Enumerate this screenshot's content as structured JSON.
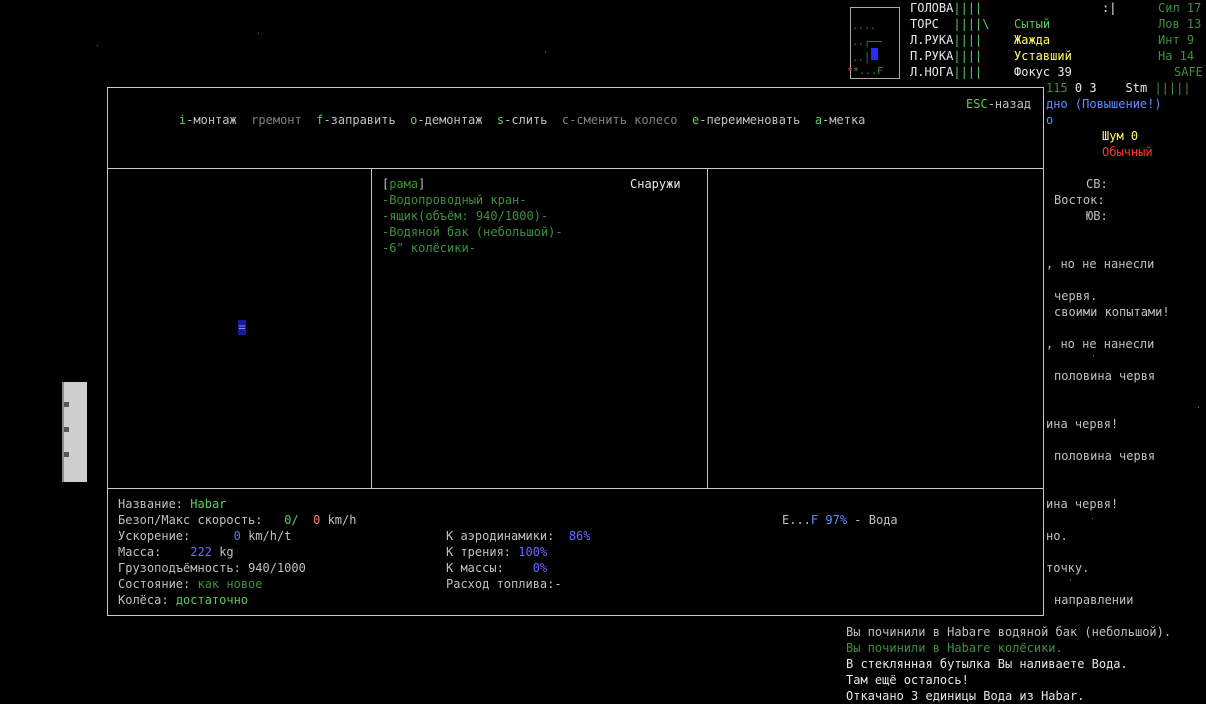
{
  "status": {
    "body_parts": [
      {
        "name": "ГОЛОВА",
        "bars": "||||"
      },
      {
        "name": "ТОРС",
        "bars": "||||\\"
      },
      {
        "name": "Л.РУКА",
        "bars": "||||"
      },
      {
        "name": "П.РУКА",
        "bars": "||||"
      },
      {
        "name": "Л.НОГА",
        "bars": "||||"
      }
    ],
    "needs": [
      "Сытый",
      "Жажда",
      "Уставший",
      "Фокус 39"
    ],
    "cursor_mark": ":|",
    "stats": [
      "Сил 17",
      "Лов 13",
      "Инт 9",
      "На 14",
      "SAFE"
    ],
    "row6": {
      "val1": "115",
      "val2": "0",
      "val3": "3",
      "stm_label": "Stm",
      "stm_bars": "|||||"
    },
    "minimap": {
      "rows": [
        "....",
        "..┌──",
        "..│",
        "*...F"
      ]
    }
  },
  "toolbar": {
    "items": [
      {
        "key": "i",
        "label": "-монтаж",
        "color": "#5fc85f",
        "label_color": "#c0c0c0"
      },
      {
        "key": "r",
        "label": "ремонт",
        "color": "#808080",
        "label_color": "#808080"
      },
      {
        "key": "f",
        "label": "-заправить",
        "color": "#5fc85f",
        "label_color": "#c0c0c0"
      },
      {
        "key": "o",
        "label": "-демонтаж",
        "color": "#5fc85f",
        "label_color": "#c0c0c0"
      },
      {
        "key": "s",
        "label": "-слить",
        "color": "#5fc85f",
        "label_color": "#c0c0c0"
      },
      {
        "key": "c",
        "label": "-сменить колесо",
        "color": "#808080",
        "label_color": "#808080"
      },
      {
        "key": "e",
        "label": "-переименовать",
        "color": "#5fc85f",
        "label_color": "#c0c0c0"
      },
      {
        "key": "a",
        "label": "-метка",
        "color": "#5fc85f",
        "label_color": "#c0c0c0"
      }
    ],
    "esc_key": "ESC",
    "esc_label": "-назад"
  },
  "parts_panel": {
    "frame_label": "рама",
    "location": "Снаружи",
    "parts": [
      "-Водопроводный кран-",
      "-ящик(объём: 940/1000)-",
      "-Водяной бак (небольшой)-",
      "-6\" колёсики-"
    ]
  },
  "vehicle_map": {
    "glyph": "="
  },
  "vehicle_info": {
    "name_label": "Название:",
    "name_value": "Habar",
    "speed_label": "Безоп/Макс скорость:",
    "speed_safe": "0/",
    "speed_max": "0",
    "speed_unit": "km/h",
    "accel_label": "Ускорение:",
    "accel_value": "0",
    "accel_unit": "km/h/t",
    "mass_label": "Масса:",
    "mass_value": "222",
    "mass_unit": "kg",
    "capacity_label": "Грузоподъёмность:",
    "capacity_value": "940/1000",
    "condition_label": "Состояние:",
    "condition_value": "как новое",
    "wheels_label": "Колёса:",
    "wheels_value": "достаточно",
    "aero_label": "К аэродинамики:",
    "aero_value": "86%",
    "friction_label": "К трения:",
    "friction_value": "100%",
    "mass_k_label": "К массы:",
    "mass_k_value": "0%",
    "fuel_label": "Расход топлива:-",
    "fuel_gauge_prefix": "E...",
    "fuel_gauge_f": "F",
    "fuel_percent": "97%",
    "fuel_type": "- Вода"
  },
  "side_panel": {
    "level_text": "дно (Повышение!)",
    "o_line": "о",
    "noise": "Шум 0",
    "mode": "Обычный",
    "dir_sv": "СВ:",
    "dir_vostok": "Восток:",
    "dir_yuv": "ЮВ:"
  },
  "right_log": [
    ", но не нанесли",
    "червя.",
    "своими копытами!",
    ", но не нанесли",
    "половина червя",
    "ина червя!",
    "половина червя",
    "ина червя!",
    "но.",
    "точку.",
    "направлении"
  ],
  "bottom_log": [
    {
      "text": "Вы починили в Habare водяной бак (небольшой).",
      "color": "#c0c0c0"
    },
    {
      "text": "Вы починили в Habare колёсики.",
      "color": "#3f8f3f"
    },
    {
      "text": "В стеклянная бутылка Вы наливаете Вода.",
      "color": "#e8e8e8"
    },
    {
      "text": "Там ещё осталось!",
      "color": "#e8e8e8"
    },
    {
      "text": "Откачано 3 единицы Вода из Habar.",
      "color": "#e8e8e8"
    }
  ]
}
